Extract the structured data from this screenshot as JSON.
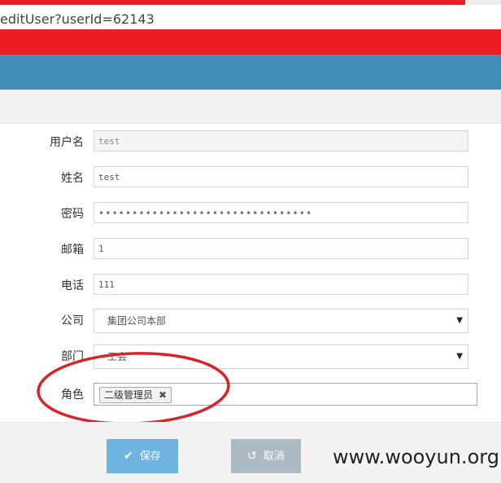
{
  "browser": {
    "url": "editUser?userId=62143"
  },
  "form": {
    "username_label": "用户名",
    "username_value": "test",
    "name_label": "姓名",
    "name_value": "test",
    "password_label": "密码",
    "password_value": "••••••••••••••••••••••••••••••••",
    "email_label": "邮箱",
    "email_value": "1",
    "phone_label": "电话",
    "phone_value": "111",
    "company_label": "公司",
    "company_value": "集团公司本部",
    "department_label": "部门",
    "department_value": "工会",
    "role_label": "角色",
    "role_tags": [
      "二级管理员"
    ]
  },
  "actions": {
    "save_label": "保存",
    "cancel_label": "取消"
  },
  "watermark": "www.wooyun.org",
  "colors": {
    "header_red": "#ec1b24",
    "header_blue": "#438eb9",
    "save_button": "#6fb3e0",
    "cancel_button": "#abbac3",
    "annotation_red": "#d9232b"
  },
  "icons": {
    "save": "check-icon",
    "cancel": "undo-icon",
    "remove_tag": "close-icon",
    "dropdown": "caret-down-icon"
  }
}
